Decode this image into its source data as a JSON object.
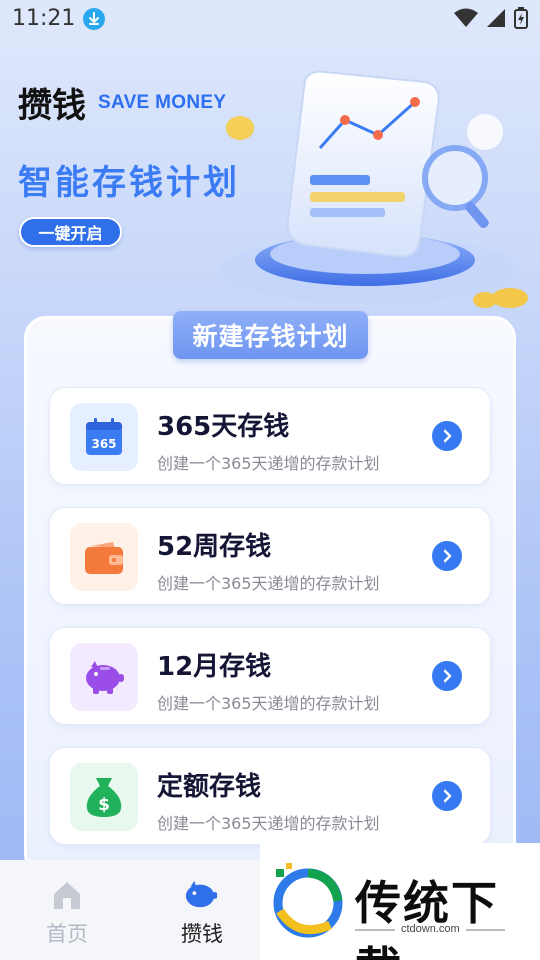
{
  "status_bar": {
    "time": "11:21"
  },
  "hero": {
    "title": "攒钱",
    "subtitle": "SAVE MONEY",
    "slogan": "智能存钱计划",
    "button_label": "一键开启"
  },
  "panel": {
    "tab_label": "新建存钱计划",
    "plans": [
      {
        "title": "365天存钱",
        "desc": "创建一个365天递增的存款计划",
        "icon": "calendar-365-icon",
        "icon_text": "365",
        "accent": "#3b7cf4",
        "icon_bg": "#e6efff"
      },
      {
        "title": "52周存钱",
        "desc": "创建一个365天递增的存款计划",
        "icon": "wallet-icon",
        "accent": "#f47a3c",
        "icon_bg": "#fff0e8"
      },
      {
        "title": "12月存钱",
        "desc": "创建一个365天递增的存款计划",
        "icon": "piggy-bank-icon",
        "accent": "#9b4de8",
        "icon_bg": "#f3eaff"
      },
      {
        "title": "定额存钱",
        "desc": "创建一个365天递增的存款计划",
        "icon": "money-bag-icon",
        "icon_text": "$",
        "accent": "#20b15a",
        "icon_bg": "#e8f8ee"
      }
    ]
  },
  "bottom_nav": {
    "items": [
      {
        "label": "首页",
        "icon": "home-icon",
        "active": false
      },
      {
        "label": "攒钱",
        "icon": "piggy-bank-icon",
        "active": true
      }
    ]
  },
  "watermark": {
    "text": "传统下载",
    "domain": "ctdown.com"
  },
  "colors": {
    "primary": "#3679f0",
    "nav_active": "#2f6fe9",
    "nav_inactive": "#b5b8c4"
  }
}
